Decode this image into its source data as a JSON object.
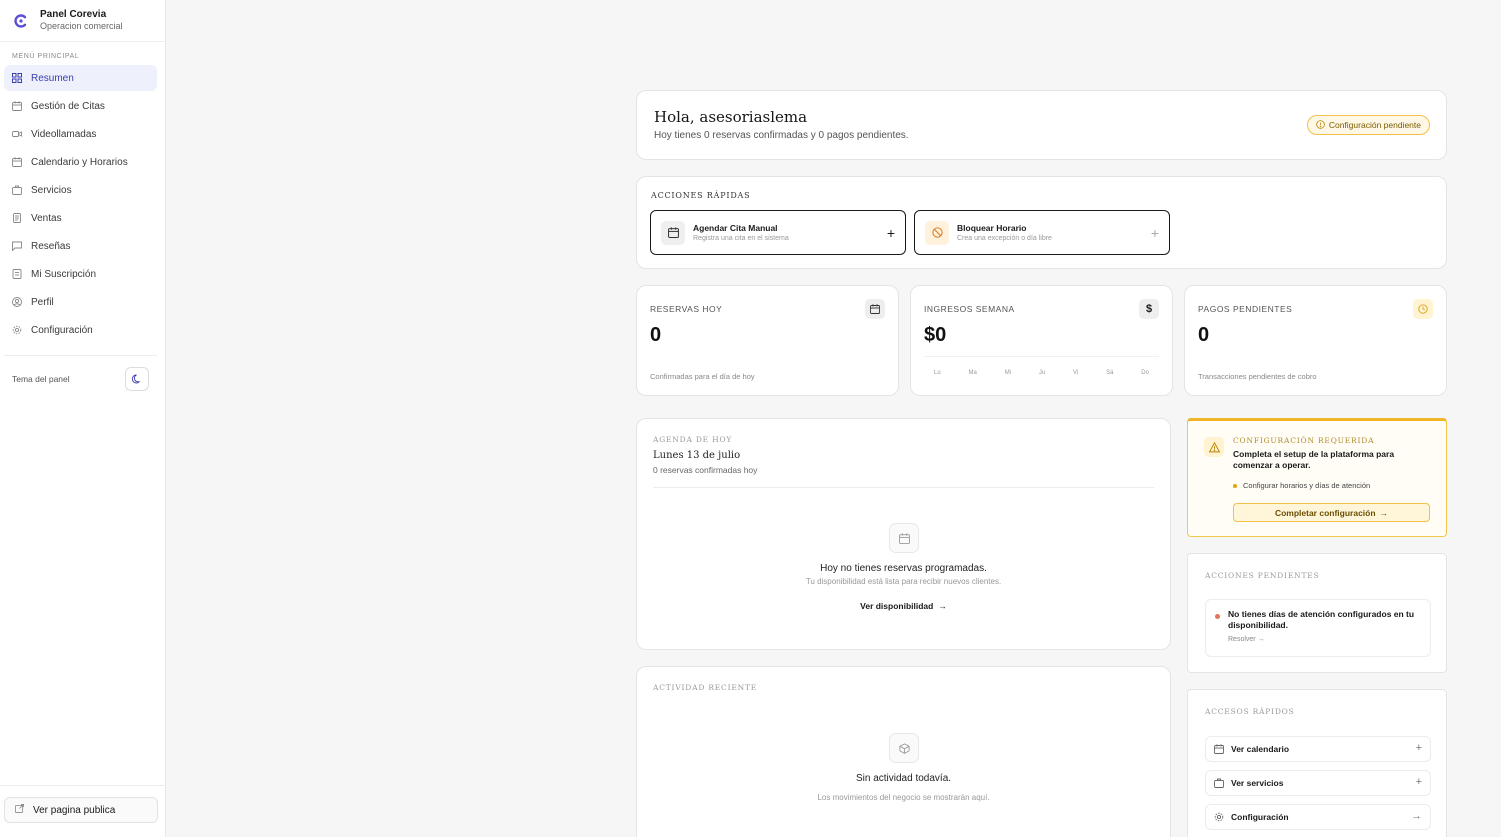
{
  "brand": {
    "name": "Panel Corevia",
    "subtitle": "Operacion comercial"
  },
  "sidebar": {
    "section_label": "MENÚ PRINCIPAL",
    "items": [
      {
        "label": "Resumen",
        "icon": "grid-icon",
        "active": true
      },
      {
        "label": "Gestión de Citas",
        "icon": "calendar-icon"
      },
      {
        "label": "Videollamadas",
        "icon": "video-icon"
      },
      {
        "label": "Calendario y Horarios",
        "icon": "calendar-icon"
      },
      {
        "label": "Servicios",
        "icon": "briefcase-icon"
      },
      {
        "label": "Ventas",
        "icon": "receipt-icon"
      },
      {
        "label": "Reseñas",
        "icon": "message-icon"
      },
      {
        "label": "Mi Suscripción",
        "icon": "subscription-icon"
      },
      {
        "label": "Perfil",
        "icon": "user-icon"
      },
      {
        "label": "Configuración",
        "icon": "gear-icon"
      }
    ],
    "theme_label": "Tema del panel",
    "public_link": "Ver pagina publica"
  },
  "greeting": {
    "title": "Hola, asesoriaslema",
    "subtitle": "Hoy tienes 0 reservas confirmadas y 0 pagos pendientes.",
    "badge": "Configuración pendiente"
  },
  "quick_actions": {
    "label": "ACCIONES RÁPIDAS",
    "items": [
      {
        "title": "Agendar Cita Manual",
        "subtitle": "Registra una cita en el sistema"
      },
      {
        "title": "Bloquear Horario",
        "subtitle": "Crea una excepción o día libre"
      }
    ]
  },
  "stats": {
    "reservas": {
      "label": "RESERVAS HOY",
      "value": "0",
      "sub": "Confirmadas para el día de hoy"
    },
    "ingresos": {
      "label": "INGRESOS SEMANA",
      "value": "$0",
      "days": [
        "Lu",
        "Ma",
        "Mi",
        "Ju",
        "Vi",
        "Sá",
        "Do"
      ]
    },
    "pagos": {
      "label": "PAGOS PENDIENTES",
      "value": "0",
      "sub": "Transacciones pendientes de cobro"
    }
  },
  "agenda": {
    "title": "AGENDA DE HOY",
    "date": "Lunes 13 de julio",
    "count": "0 reservas confirmadas hoy",
    "empty_title": "Hoy no tienes reservas programadas.",
    "empty_sub": "Tu disponibilidad está lista para recibir nuevos clientes.",
    "cta": "Ver disponibilidad"
  },
  "activity": {
    "title": "ACTIVIDAD RECIENTE",
    "empty_title": "Sin actividad todavía.",
    "empty_sub": "Los movimientos del negocio se mostrarán aquí."
  },
  "config_required": {
    "title": "CONFIGURACIÓN REQUERIDA",
    "message": "Completa el setup de la plataforma para comenzar a operar.",
    "bullet": "Configurar horarios y días de atención",
    "cta": "Completar configuración"
  },
  "pending_actions": {
    "title": "ACCIONES PENDIENTES",
    "item": "No tienes días de atención configurados en tu disponibilidad.",
    "resolve": "Resolver"
  },
  "quick_access": {
    "title": "ACCESOS RÁPIDOS",
    "items": [
      {
        "label": "Ver calendario",
        "icon": "calendar-icon",
        "action": "plus"
      },
      {
        "label": "Ver servicios",
        "icon": "briefcase-icon",
        "action": "plus"
      },
      {
        "label": "Configuración",
        "icon": "gear-icon",
        "action": "arrow"
      }
    ]
  },
  "colors": {
    "accent": "#3b3fae",
    "active_bg": "#eef0fb",
    "warning": "#f0b429"
  }
}
